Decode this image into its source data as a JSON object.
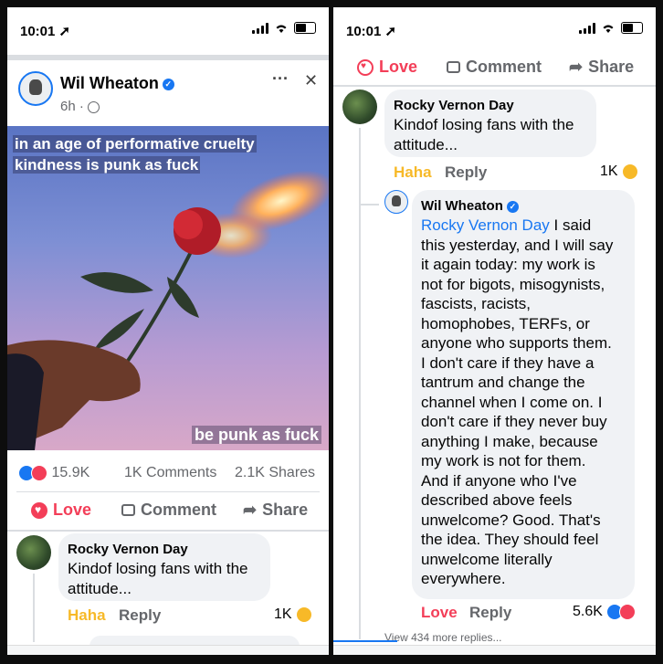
{
  "left": {
    "status": {
      "time": "10:01"
    },
    "post": {
      "author": "Wil Wheaton",
      "time": "6h ·",
      "image_text_top_line1": "in an age of performative cruelty",
      "image_text_top_line2": "kindness is punk as fuck",
      "image_text_bottom": "be punk as fuck",
      "reaction_count": "15.9K",
      "comments": "1K Comments",
      "shares": "2.1K Shares",
      "more": "···",
      "close": "✕"
    },
    "actions": {
      "love": "Love",
      "comment": "Comment",
      "share": "Share"
    },
    "comment": {
      "author": "Rocky Vernon Day",
      "text_line1": "Kindof losing fans with the",
      "text_line2": "attitude...",
      "haha": "Haha",
      "reply": "Reply",
      "count": "1K"
    }
  },
  "right": {
    "status": {
      "time": "10:01"
    },
    "actions": {
      "love": "Love",
      "comment": "Comment",
      "share": "Share"
    },
    "comment": {
      "author": "Rocky Vernon Day",
      "text_line1": "Kindof losing fans with the",
      "text_line2": "attitude...",
      "haha": "Haha",
      "reply": "Reply",
      "count": "1K"
    },
    "reply": {
      "author": "Wil Wheaton",
      "mention": "Rocky Vernon Day",
      "lines": [
        " I said",
        "this yesterday, and I will say",
        "it again today: my work is",
        "not for bigots, misogynists,",
        "fascists, racists,",
        "homophobes, TERFs, or",
        "anyone who supports them.",
        "I don't care if they have a",
        "tantrum and change the",
        "channel when I come on. I",
        "don't care if they never buy",
        "anything I make, because",
        "my work is not for them.",
        "And if anyone who I've",
        "described above feels",
        "unwelcome? Good. That's",
        "the idea. They should feel",
        "unwelcome literally",
        "everywhere."
      ],
      "love": "Love",
      "reply": "Reply",
      "count": "5.6K",
      "view_more": "View 434 more replies..."
    }
  }
}
